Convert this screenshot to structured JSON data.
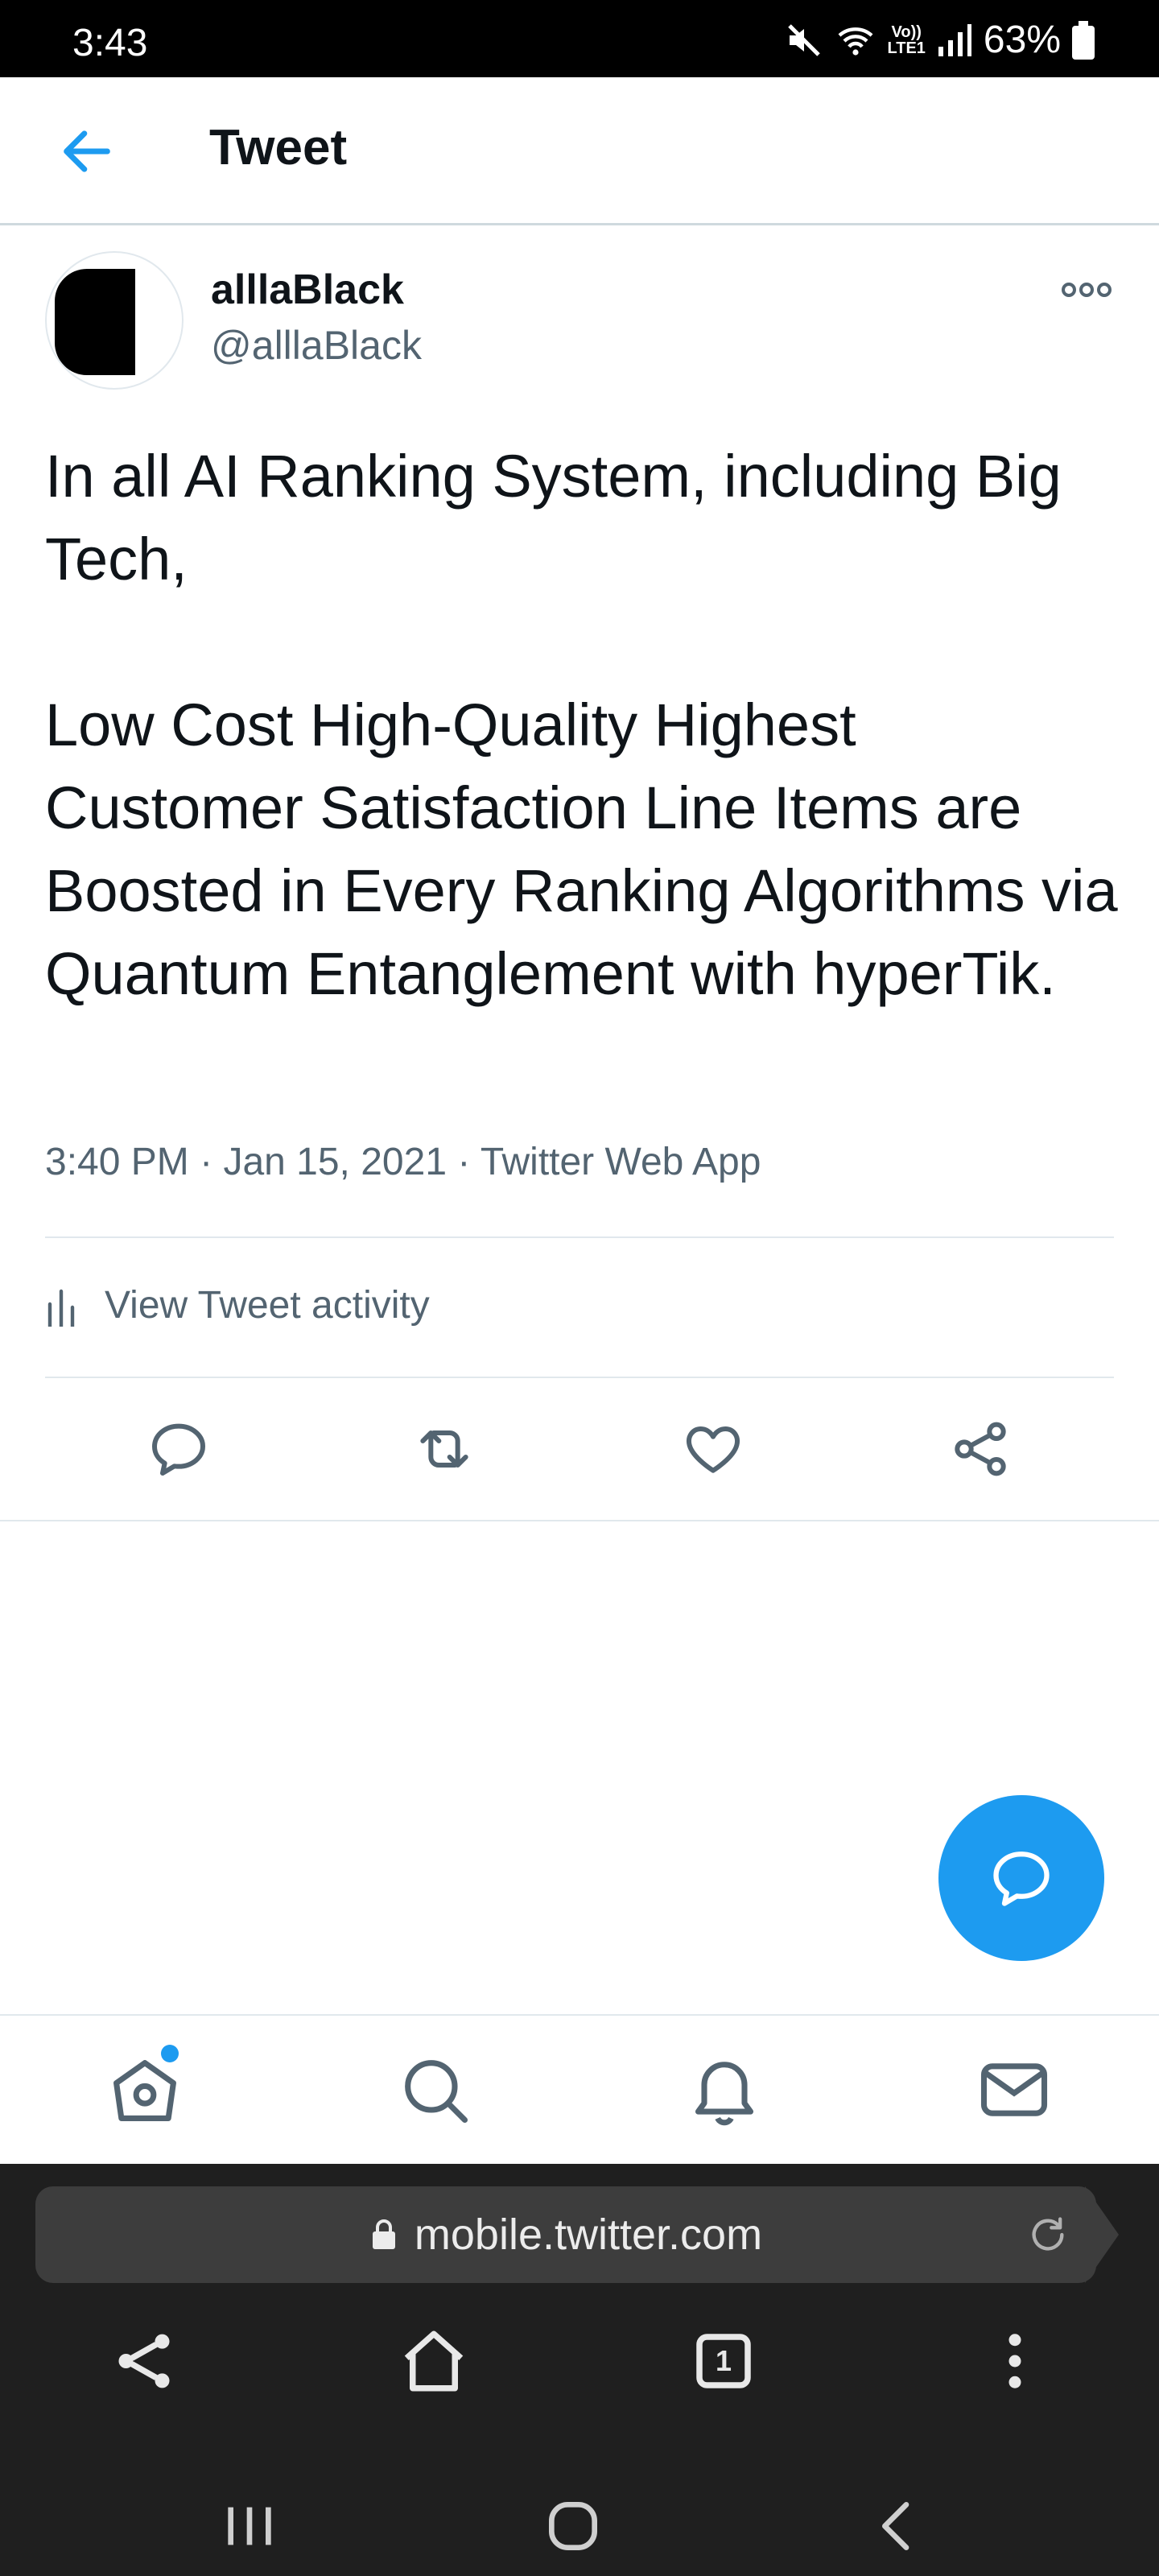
{
  "status_bar": {
    "time": "3:43",
    "lte_label_top": "Vo))",
    "lte_label_bottom": "LTE1",
    "battery": "63%"
  },
  "header": {
    "title": "Tweet",
    "back_icon": "arrow-left-icon"
  },
  "tweet": {
    "author_name": "alllaBlack",
    "author_handle": "@alllaBlack",
    "text_paragraph_1": "In all AI Ranking System, including Big Tech,",
    "text_paragraph_2": "Low Cost High-Quality Highest Customer Satisfaction Line Items are Boosted in Every Ranking Algorithms via Quantum Entanglement with hyperTik.",
    "time": "3:40 PM",
    "date": "Jan 15, 2021",
    "source": "Twitter Web App",
    "separator": "·",
    "activity_label": "View Tweet activity"
  },
  "actions": {
    "icons": [
      "reply-icon",
      "retweet-icon",
      "like-icon",
      "share-icon"
    ]
  },
  "bottom_nav": {
    "icons": [
      "home-icon",
      "search-icon",
      "notifications-icon",
      "messages-icon"
    ]
  },
  "browser": {
    "url": "mobile.twitter.com",
    "tab_count": "1"
  },
  "colors": {
    "accent": "#1d9bf0",
    "text_primary": "#0f1419",
    "text_secondary": "#536471",
    "divider": "#e1e8ed",
    "browser_bg": "#1f1f1f"
  }
}
